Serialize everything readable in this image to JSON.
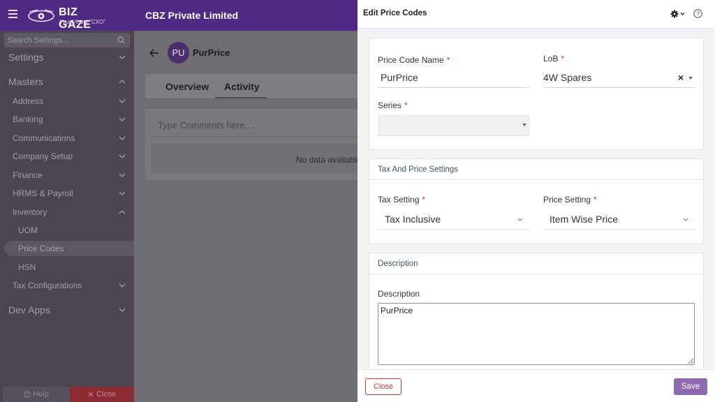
{
  "brand": {
    "name": "BIZ GAZE",
    "tm": "TM",
    "tagline": "Your Virtual \"CXO\"",
    "accent": "#4e2a84"
  },
  "header": {
    "company": "CBZ Private Limited"
  },
  "sidebar": {
    "search_placeholder": "Search Settings...",
    "items": [
      {
        "label": "Settings",
        "chevron": "down"
      },
      {
        "label": "Masters",
        "chevron": "up"
      },
      {
        "label": "Address",
        "chevron": "down"
      },
      {
        "label": "Banking",
        "chevron": "down"
      },
      {
        "label": "Communications",
        "chevron": "down"
      },
      {
        "label": "Company Setup",
        "chevron": "down"
      },
      {
        "label": "Finance",
        "chevron": "down"
      },
      {
        "label": "HRMS & Payroll",
        "chevron": "down"
      },
      {
        "label": "Inventory",
        "chevron": "up"
      },
      {
        "label": "UOM"
      },
      {
        "label": "Price Codes",
        "active": true
      },
      {
        "label": "HSN"
      },
      {
        "label": "Tax Configurations",
        "chevron": "down"
      },
      {
        "label": "Dev Apps",
        "chevron": "down"
      }
    ],
    "footer": {
      "help_label": "Help",
      "close_label": "Close"
    }
  },
  "main": {
    "avatar_initials": "PU",
    "record_title": "PurPrice",
    "tabs": [
      {
        "label": "Overview"
      },
      {
        "label": "Activity",
        "active": true
      }
    ],
    "comment_placeholder": "Type Comments here....",
    "no_data": "No data available"
  },
  "panel": {
    "title": "Edit Price Codes",
    "fields": {
      "price_code_name": {
        "label": "Price Code Name",
        "value": "PurPrice",
        "required": "*"
      },
      "lob": {
        "label": "LoB",
        "value": "4W Spares",
        "required": "*",
        "clear": "×"
      },
      "series": {
        "label": "Series",
        "value": "",
        "required": "*"
      }
    },
    "tax_section": {
      "title": "Tax And Price Settings",
      "tax_setting": {
        "label": "Tax Setting",
        "value": "Tax Inclusive",
        "required": "*"
      },
      "price_setting": {
        "label": "Price Setting",
        "value": "Item Wise Price",
        "required": "*"
      }
    },
    "description_section": {
      "title": "Description",
      "label": "Description",
      "value": "PurPrice"
    },
    "footer": {
      "close_label": "Close",
      "save_label": "Save"
    }
  }
}
